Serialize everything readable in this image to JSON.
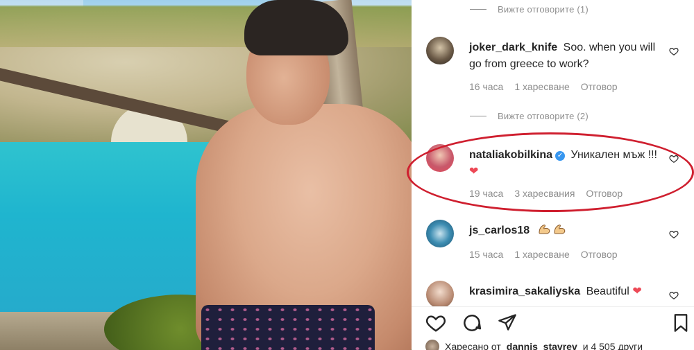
{
  "comments_panel": {
    "view_replies": [
      "Вижте отговорите (1)",
      "Вижте отговорите (2)"
    ],
    "comments": [
      {
        "username": "joker_dark_knife",
        "text": "Soo. when you will go from greece to work?",
        "time": "16 часа",
        "likes": "1 харесване",
        "reply": "Отговор"
      },
      {
        "username": "nataliakobilkina",
        "verified": true,
        "text": "Уникален мъж !!!",
        "time": "19 часа",
        "likes": "3 харесвания",
        "reply": "Отговор"
      },
      {
        "username": "js_carlos18",
        "text": "",
        "time": "15 часа",
        "likes": "1 харесване",
        "reply": "Отговор"
      },
      {
        "username": "krasimira_sakaliyska",
        "text": "Beautiful",
        "time": "",
        "likes": "",
        "reply": ""
      }
    ],
    "liked_by": {
      "prefix": "Харесано от",
      "user": "dannis_stavrev",
      "suffix": "и 4 505 други"
    }
  },
  "icons": {
    "like": "heart-outline-icon",
    "comment": "comment-bubble-icon",
    "share": "paper-plane-icon",
    "save": "bookmark-icon",
    "verified": "verified-badge-icon"
  },
  "colors": {
    "highlight": "#cf1f2f",
    "muted": "#8e8e8e",
    "verified": "#3897f0",
    "heart": "#ed4956"
  }
}
